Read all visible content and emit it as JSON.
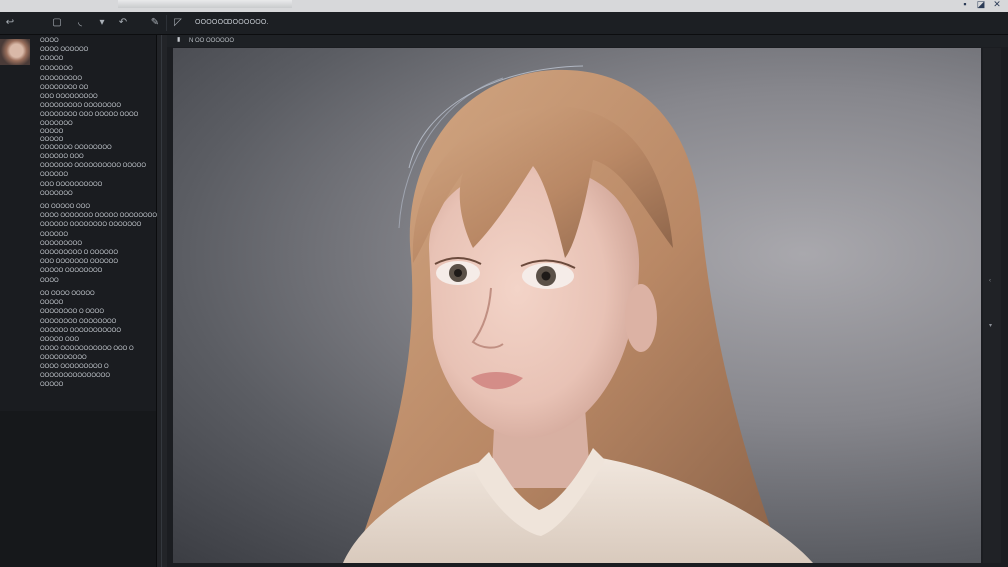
{
  "toolbar": {
    "items": [
      {
        "icon": "arrow-icon"
      },
      {
        "icon": "frame-icon"
      },
      {
        "icon": "brush-icon"
      },
      {
        "icon": "stamp-icon"
      },
      {
        "icon": "undo-icon"
      },
      {
        "icon": "pen-icon"
      },
      {
        "icon": "crop-icon"
      }
    ],
    "label_1": "OOOOOO",
    "label_2": "OOOOOOO."
  },
  "window_controls": [
    "minimize-icon",
    "restore-icon",
    "close-icon"
  ],
  "document_tab": {
    "label": "N OO OOOOOO"
  },
  "layers_panel": {
    "items": [
      "OOOO",
      "OOOO OOOOOO",
      "OOOOO",
      "OOOOOOO",
      "OOOOOOOOO",
      "OOOOOOOO OO",
      "OOO OOOOOOOOO",
      "OOOOOOOOO OOOOOOOO",
      "OOOOOOOO OOO OOOOO OOOO",
      "OOOOOOO",
      "OOOOO",
      "OOOOO",
      "OOOOOOO OOOOOOOO",
      "OOOOOO OOO",
      "OOOOOOO OOOOOOOOOO OOOOO",
      "OOOOOO",
      "OOO OOOOOOOOOO",
      "OOOOOOO",
      "OO OOOOO OOO",
      "OOOO OOOOOOO OOOOO OOOOOOOO",
      "OOOOOO OOOOOOOO OOOOOOO",
      "OOOOOO",
      "OOOOOOOOO",
      "OOOOOOOOO O OOOOOO",
      "OOO OOOOOOO OOOOOO",
      "OOOOO OOOOOOOO",
      "OOOO",
      "OO OOOO OOOOO",
      "OOOOO",
      "OOOOOOOO O OOOO",
      "OOOOOOOO OOOOOOOO",
      "OOOOOO OOOOOOOOOOO",
      "OOOOO OOO",
      "OOOO OOOOOOOOOOO OOO O",
      "OOOOOOOOOO",
      "OOOO OOOOOOOOO O",
      "OOOOOOOOOOOOOOO",
      "OOOOO"
    ]
  },
  "canvas": {
    "skin_color": "#e8c2b5",
    "hair_color": "#b98865",
    "sweater_color": "#e9ddd2",
    "background_color": "#8a8a90"
  }
}
